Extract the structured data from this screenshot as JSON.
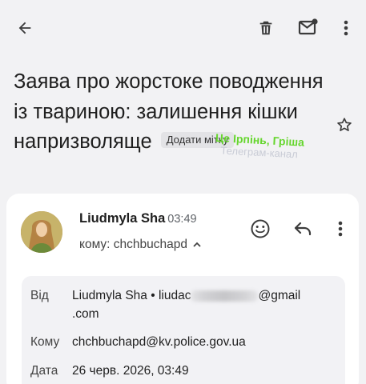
{
  "toolbar": {
    "icons": [
      "back-arrow-icon",
      "trash-icon",
      "mark-unread-icon",
      "more-vert-icon"
    ]
  },
  "subject": {
    "text": "Заява про жорстоке поводження із твариною: залишення кішки напризволяще",
    "label_chip": "Додати мітку"
  },
  "watermark": {
    "line1": "Це Ірпінь, Гріша",
    "line2": "Телеграм-канал"
  },
  "message": {
    "sender_name": "Liudmyla Sha",
    "time": "03:49",
    "to_summary": "кому: chchbuchapd",
    "details": {
      "from_label": "Від",
      "from_value_start": "Liudmyla Sha • liudac",
      "from_value_end": "@gmail",
      "from_value_line2": ".com",
      "to_label": "Кому",
      "to_value": "chchbuchapd@kv.police.gov.ua",
      "date_label": "Дата",
      "date_value": "26 черв. 2026, 03:49"
    }
  },
  "colors": {
    "background": "#f2f2f4",
    "card": "#ffffff",
    "watermark_green": "#66d62e",
    "text": "#1f1f1f"
  }
}
